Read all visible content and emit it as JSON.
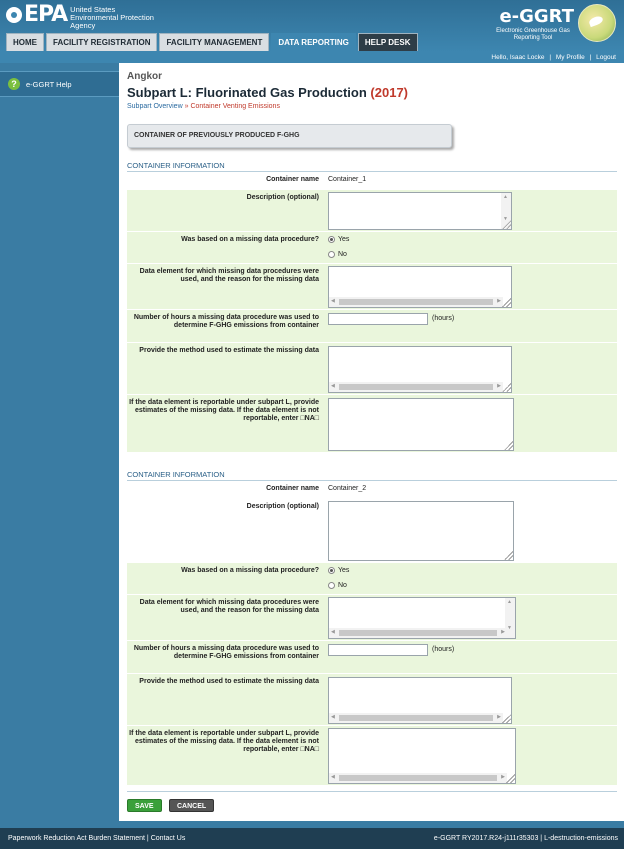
{
  "header": {
    "epa_mark": "EPA",
    "epa_sub": [
      "United States",
      "Environmental Protection",
      "Agency"
    ],
    "app_logo": "e-GGRT",
    "app_sub": [
      "Electronic Greenhouse Gas",
      "Reporting Tool"
    ]
  },
  "nav": {
    "tabs": [
      {
        "label": "HOME"
      },
      {
        "label": "FACILITY REGISTRATION"
      },
      {
        "label": "FACILITY MANAGEMENT"
      },
      {
        "label": "DATA REPORTING"
      },
      {
        "label": "HELP DESK"
      }
    ]
  },
  "userbar": {
    "greeting": "Hello, Isaac Locke",
    "profile": "My Profile",
    "logout": "Logout",
    "sep": "|"
  },
  "sidebar": {
    "help_icon": "?",
    "help_label": "e-GGRT Help"
  },
  "main": {
    "facility": "Angkor",
    "title": "Subpart L: Fluorinated Gas Production",
    "year": "(2017)",
    "crumb_link": "Subpart Overview",
    "crumb_sep": "»",
    "crumb_current": "Container Venting Emissions",
    "section_title": "CONTAINER OF PREVIOUSLY PRODUCED F-GHG"
  },
  "labels": {
    "container_info": "CONTAINER INFORMATION",
    "container_name": "Container name",
    "description": "Description (optional)",
    "missing_proc": "Was based on a missing data procedure?",
    "yes": "Yes",
    "no": "No",
    "data_element": "Data element for which missing data procedures were used, and the reason for the missing data",
    "hours": "Number of hours a missing data procedure was used to determine F-GHG emissions from container",
    "hours_unit": "(hours)",
    "method": "Provide the method used to estimate the missing data",
    "estimates": "If the data element is reportable under subpart L, provide estimates of the missing data. If the data element is not reportable, enter □NA□"
  },
  "containers": [
    {
      "name": "Container_1",
      "missing_yes": true
    },
    {
      "name": "Container_2",
      "missing_yes": true
    }
  ],
  "actions": {
    "save": "SAVE",
    "cancel": "CANCEL"
  },
  "footer": {
    "paperwork": "Paperwork Reduction Act Burden Statement",
    "contact": "Contact Us",
    "sep": "|",
    "version": "e-GGRT RY2017.R24-j111r35303",
    "page_id": "L-destruction-emissions"
  }
}
